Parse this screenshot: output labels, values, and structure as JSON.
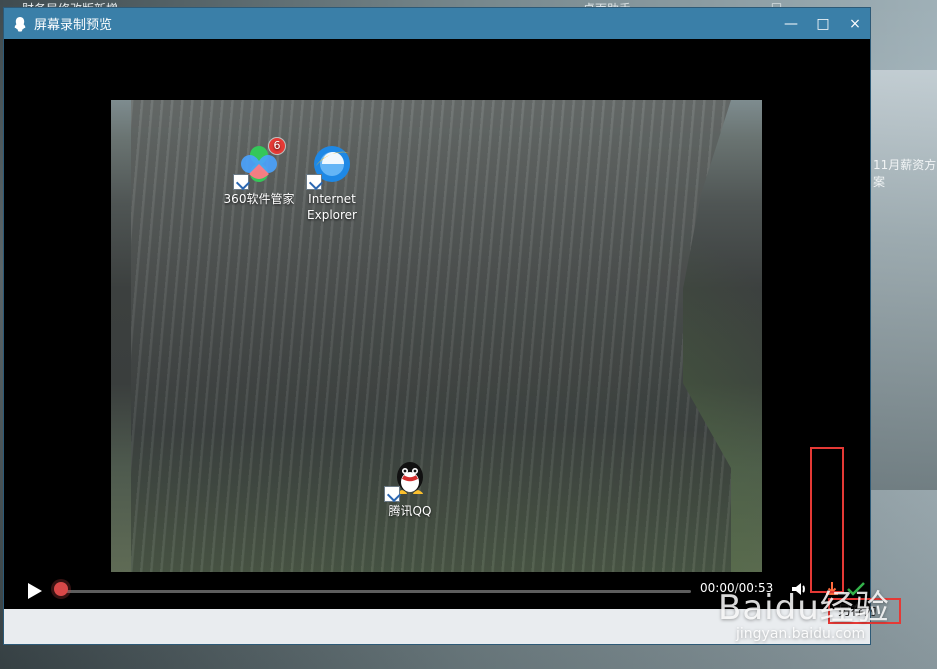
{
  "background": {
    "top_left_text": "财务局修改版新增",
    "top_mid_text": "桌面助手",
    "right_side_text": "11月薪资方案"
  },
  "window": {
    "title": "屏幕录制预览",
    "controls": {
      "minimize_label": "—",
      "maximize_label": "□",
      "close_label": "×"
    }
  },
  "desktop_icons": [
    {
      "label": "360软件管家",
      "badge": "6",
      "icon": "360-software-manager-icon"
    },
    {
      "label": "Internet\nExplorer",
      "icon": "internet-explorer-icon"
    },
    {
      "label": "腾讯QQ",
      "icon": "qq-penguin-icon"
    }
  ],
  "player": {
    "time_current": "00:00",
    "time_total": "00:53",
    "progress_fraction": 0.0,
    "icons": {
      "play": "play-icon",
      "volume": "volume-icon",
      "download": "download-icon",
      "confirm": "checkmark-icon"
    }
  },
  "annotations": {
    "save_hint_text": "另存为"
  },
  "watermark": {
    "main": "Baidu经验",
    "sub": "jingyan.baidu.com"
  },
  "colors": {
    "title_bar": "#3a7fa8",
    "progress_accent": "#d84848",
    "annotation_red": "#e53935",
    "confirm_green": "#34b34a"
  }
}
